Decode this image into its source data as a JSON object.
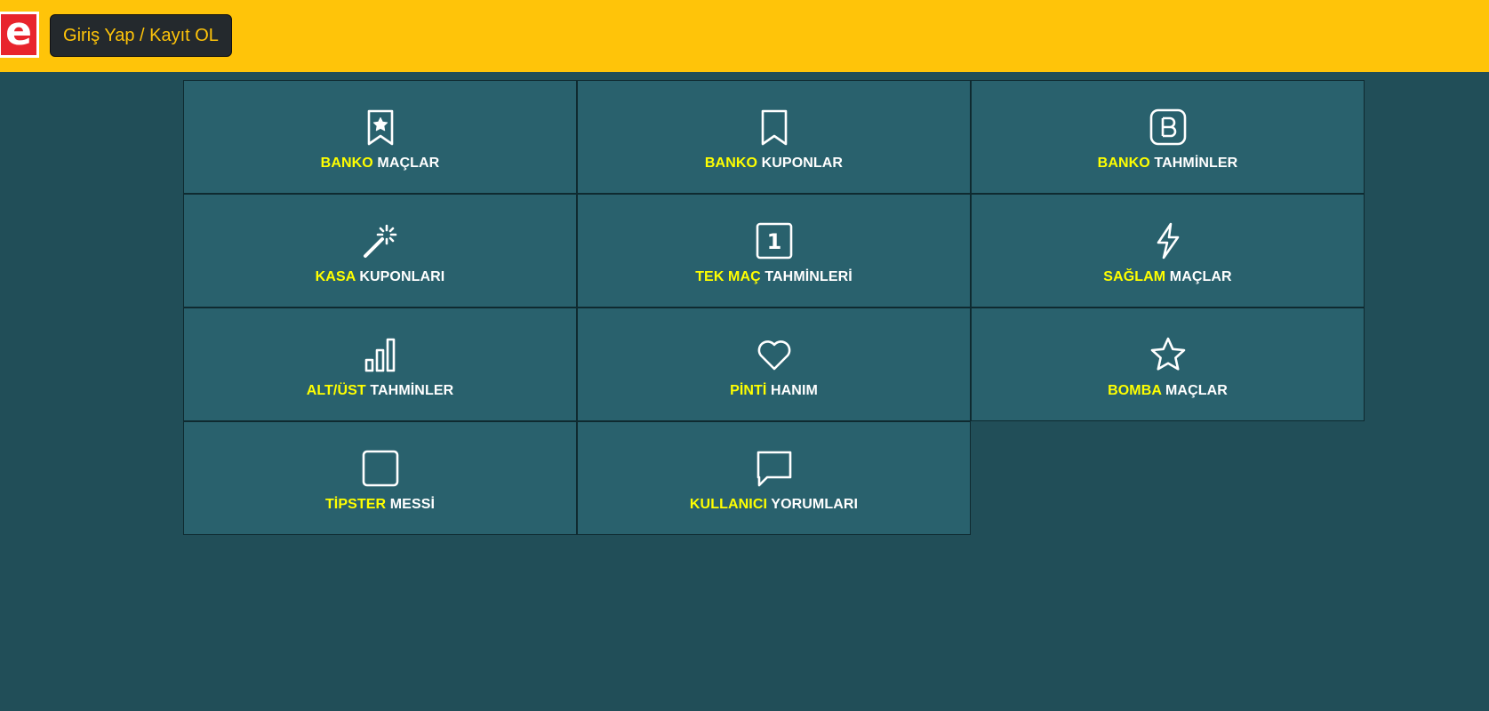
{
  "header": {
    "logo_letter": "e",
    "login_label": "Giriş Yap / Kayıt OL",
    "colors": {
      "bar": "#ffc409",
      "logo_bg": "#e8242c",
      "button_bg": "#24292d",
      "button_text": "#ffc409"
    }
  },
  "tiles": [
    {
      "highlight": "BANKO",
      "rest": "MAÇLAR",
      "icon": "bookmark-star-icon"
    },
    {
      "highlight": "BANKO",
      "rest": "KUPONLAR",
      "icon": "bookmark-icon"
    },
    {
      "highlight": "BANKO",
      "rest": "TAHMİNLER",
      "icon": "b-square-icon"
    },
    {
      "highlight": "KASA",
      "rest": "KUPONLARI",
      "icon": "magic-wand-icon"
    },
    {
      "highlight": "TEK MAÇ",
      "rest": "TAHMİNLERİ",
      "icon": "number-one-square-icon",
      "icon_text": "1"
    },
    {
      "highlight": "SAĞLAM",
      "rest": "MAÇLAR",
      "icon": "lightning-icon"
    },
    {
      "highlight": "ALT/ÜST",
      "rest": "TAHMİNLER",
      "icon": "bar-chart-icon"
    },
    {
      "highlight": "PİNTİ",
      "rest": "HANIM",
      "icon": "heart-icon"
    },
    {
      "highlight": "BOMBA",
      "rest": "MAÇLAR",
      "icon": "star-icon"
    },
    {
      "highlight": "TİPSTER",
      "rest": "MESSİ",
      "icon": "square-icon"
    },
    {
      "highlight": "KULLANICI",
      "rest": "YORUMLARI",
      "icon": "chat-icon"
    }
  ],
  "colors": {
    "page_bg": "#214e58",
    "tile_bg": "#29616d",
    "highlight": "#ffff00",
    "label": "#ffffff"
  }
}
